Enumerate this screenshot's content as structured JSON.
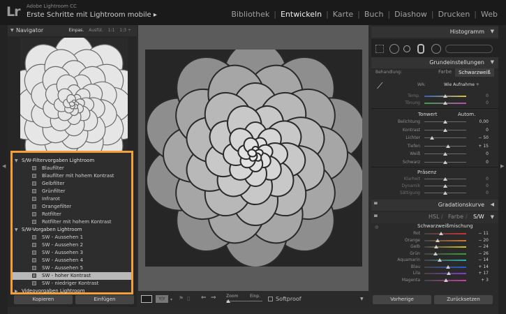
{
  "app": {
    "logo": "Lr",
    "app_name": "Adobe Lightroom CC",
    "catalog": "Erste Schritte mit Lightroom mobile ▸"
  },
  "modules": [
    "Bibliothek",
    "Entwickeln",
    "Karte",
    "Buch",
    "Diashow",
    "Drucken",
    "Web"
  ],
  "active_module": "Entwickeln",
  "navigator": {
    "title": "Navigator",
    "options": [
      "Einpas.",
      "Ausfül.",
      "1:1",
      "1:3 ÷"
    ]
  },
  "presets": [
    {
      "label": "S/W-Filtervorgaben Lightroom",
      "folder": true,
      "open": true
    },
    {
      "label": "Blaufilter"
    },
    {
      "label": "Blaufilter mit hohem Kontrast"
    },
    {
      "label": "Gelbfilter"
    },
    {
      "label": "Grünfilter"
    },
    {
      "label": "Infrarot"
    },
    {
      "label": "Orangefilter"
    },
    {
      "label": "Rotfilter"
    },
    {
      "label": "Rotfilter mit hohem Kontrast"
    },
    {
      "label": "S/W-Vorgaben Lightroom",
      "folder": true,
      "open": true
    },
    {
      "label": "SW - Aussehen 1"
    },
    {
      "label": "SW - Aussehen 2"
    },
    {
      "label": "SW - Aussehen 3"
    },
    {
      "label": "SW - Aussehen 4"
    },
    {
      "label": "SW - Aussehen 5"
    },
    {
      "label": "SW - hoher Kontrast",
      "selected": true
    },
    {
      "label": "SW - niedriger Kontrast"
    },
    {
      "label": "Videovorgaben Lightroom",
      "folder": true,
      "open": false
    }
  ],
  "left_buttons": {
    "copy": "Kopieren",
    "paste": "Einfügen"
  },
  "toolbar": {
    "zoom_label": "Zoom",
    "zoom_value": "Einp.",
    "softproof": "Softproof"
  },
  "right": {
    "histogram": "Histogramm",
    "basic": "Grundeinstellungen",
    "treatment_label": "Behandlung:",
    "treatment_color": "Farbe",
    "treatment_bw": "Schwarzweiß",
    "wb_label": "WA:",
    "wb_value": "Wie Aufnahme ÷",
    "tone_label": "Tonwert",
    "auto_label": "Autom.",
    "presence_label": "Präsenz",
    "gradation": "Gradationskurve",
    "tabs": {
      "hsl": "HSL",
      "color": "Farbe",
      "bw": "S/W",
      "sep": "/"
    },
    "bw_mix": "Schwarzweißmischung"
  },
  "wb_sliders": [
    {
      "label": "Temp.",
      "value": "0"
    },
    {
      "label": "Tönung",
      "value": "0"
    }
  ],
  "tone_sliders": [
    {
      "label": "Belichtung",
      "value": "0,00"
    },
    {
      "label": "Kontrast",
      "value": "0"
    },
    {
      "label": "Lichter",
      "value": "− 50"
    },
    {
      "label": "Tiefen",
      "value": "+ 15"
    },
    {
      "label": "Weiß",
      "value": "0"
    },
    {
      "label": "Schwarz",
      "value": "0"
    }
  ],
  "presence_sliders": [
    {
      "label": "Klarheit",
      "value": "0"
    },
    {
      "label": "Dynamik",
      "value": "0"
    },
    {
      "label": "Sättigung",
      "value": "0"
    }
  ],
  "bw_sliders": [
    {
      "label": "Rot",
      "value": "− 11"
    },
    {
      "label": "Orange",
      "value": "− 20"
    },
    {
      "label": "Gelb",
      "value": "− 24"
    },
    {
      "label": "Grün",
      "value": "− 26"
    },
    {
      "label": "Aquamarin",
      "value": "− 14"
    },
    {
      "label": "Blau",
      "value": "+ 14"
    },
    {
      "label": "Lila",
      "value": "+ 17"
    },
    {
      "label": "Magenta",
      "value": "+ 3"
    }
  ],
  "right_buttons": {
    "previous": "Vorherige",
    "reset": "Zurücksetzen"
  },
  "colors": {
    "highlight": "#f4a03a",
    "active_text": "#f0f0f0"
  }
}
